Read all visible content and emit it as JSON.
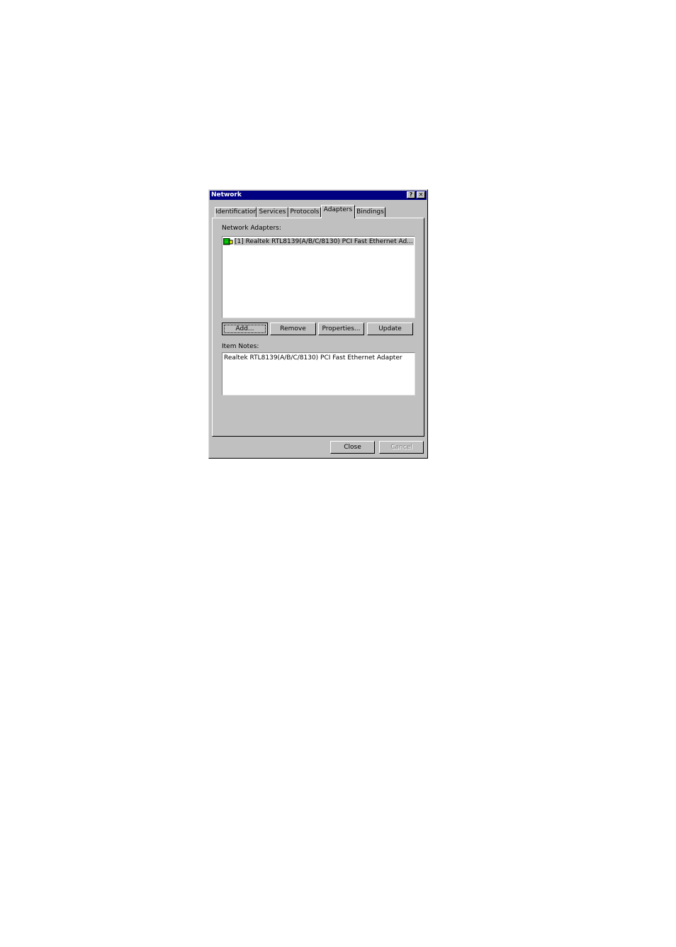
{
  "window": {
    "title": "Network",
    "help_glyph": "?",
    "close_glyph": "✕"
  },
  "tabs": [
    {
      "label": "Identification",
      "active": false
    },
    {
      "label": "Services",
      "active": false
    },
    {
      "label": "Protocols",
      "active": false
    },
    {
      "label": "Adapters",
      "active": true
    },
    {
      "label": "Bindings",
      "active": false
    }
  ],
  "adapters_panel": {
    "list_label": "Network Adapters:",
    "items": [
      {
        "label": "[1] Realtek RTL8139(A/B/C/8130) PCI Fast Ethernet Ad...",
        "icon": "network-adapter-icon",
        "selected": true
      }
    ],
    "buttons": {
      "add": "Add...",
      "remove": "Remove",
      "properties": "Properties...",
      "update": "Update"
    },
    "notes_label": "Item Notes:",
    "notes_text": "Realtek RTL8139(A/B/C/8130) PCI Fast Ethernet Adapter"
  },
  "footer": {
    "close": "Close",
    "cancel": "Cancel",
    "cancel_disabled": true
  }
}
